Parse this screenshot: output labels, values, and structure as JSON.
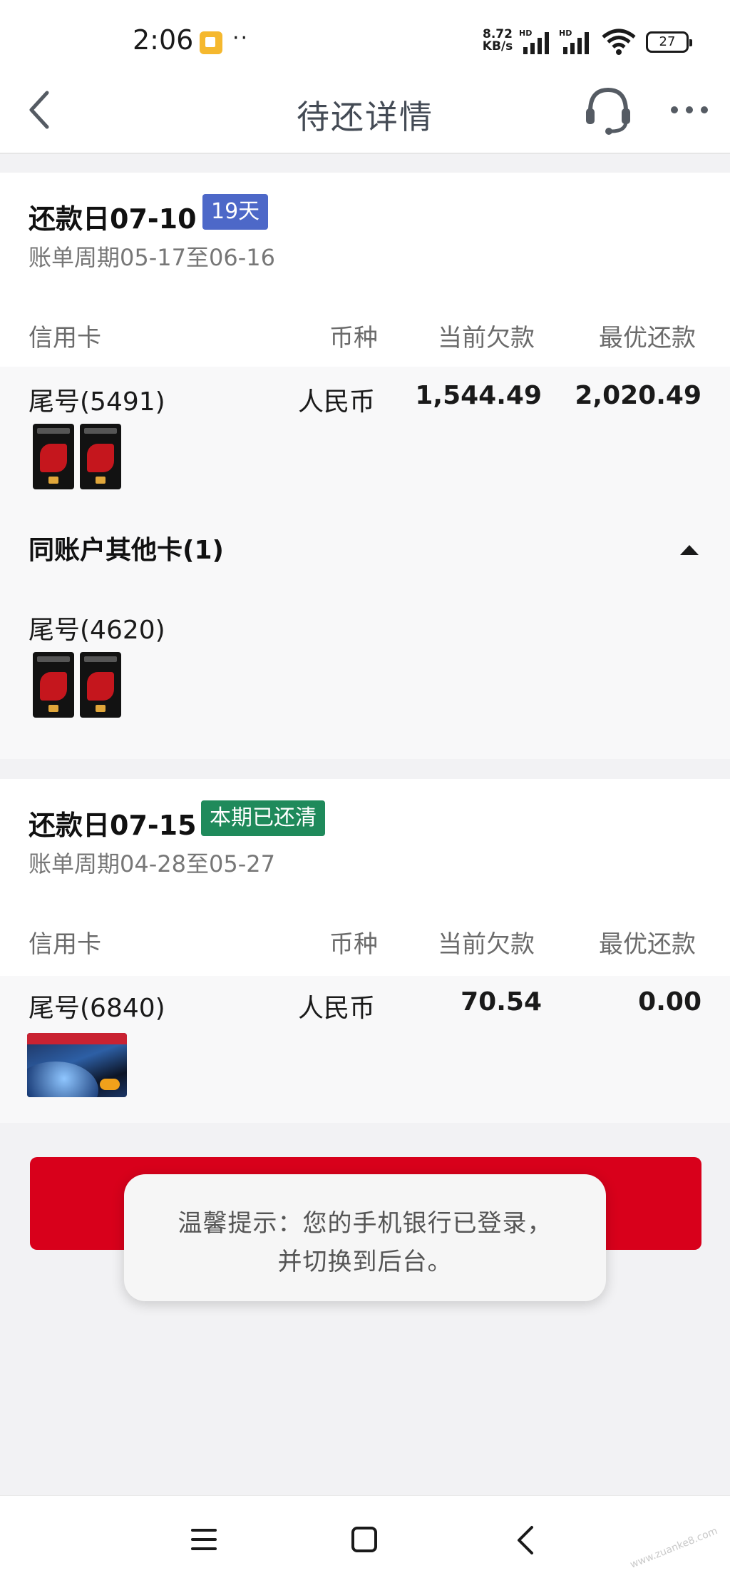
{
  "status_bar": {
    "time": "2:06",
    "more": "··",
    "net_speed_value": "8.72",
    "net_speed_unit": "KB/s",
    "signal_label": "HD",
    "battery": "27"
  },
  "nav": {
    "title": "待还详情"
  },
  "bill1": {
    "due_title": "还款日07-10",
    "days_badge": "19天",
    "cycle": "账单周期05-17至06-16",
    "headers": {
      "card": "信用卡",
      "currency": "币种",
      "current_debt": "当前欠款",
      "best_payment": "最优还款"
    },
    "row": {
      "card": "尾号(5491)",
      "currency": "人民币",
      "current_debt": "1,544.49",
      "best_payment": "2,020.49"
    },
    "other_cards_title": "同账户其他卡(1)",
    "other_card": "尾号(4620)"
  },
  "bill2": {
    "due_title": "还款日07-15",
    "status_badge": "本期已还清",
    "cycle": "账单周期04-28至05-27",
    "headers": {
      "card": "信用卡",
      "currency": "币种",
      "current_debt": "当前欠款",
      "best_payment": "最优还款"
    },
    "row": {
      "card": "尾号(6840)",
      "currency": "人民币",
      "current_debt": "70.54",
      "best_payment": "0.00"
    }
  },
  "toast": {
    "line1": "温馨提示：您的手机银行已登录，",
    "line2": "并切换到后台。"
  },
  "watermark": "www.zuanke8.com",
  "colors": {
    "accent_red": "#d8001b",
    "badge_blue": "#4d68c8",
    "badge_green": "#1f8a5b"
  }
}
